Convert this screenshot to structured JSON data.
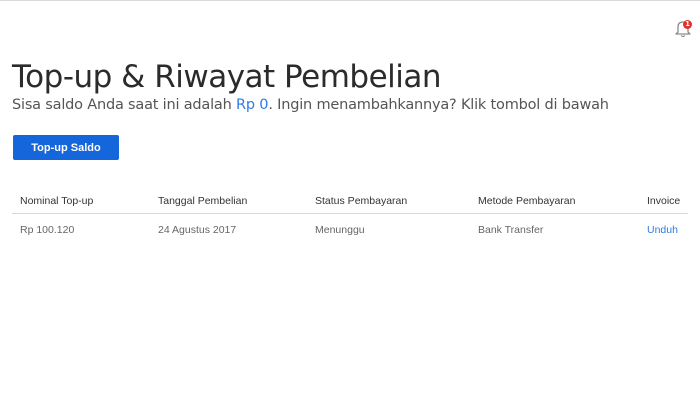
{
  "header": {
    "notification_icon": "bell-icon",
    "notification_badge": "1",
    "badge_color": "#e0322d"
  },
  "main": {
    "title": "Top-up & Riwayat Pembelian",
    "subtitle_prefix": "Sisa saldo Anda saat ini adalah ",
    "balance": "Rp 0",
    "subtitle_suffix": ". Ingin menambahkannya? Klik tombol di bawah",
    "topup_button_label": "Top-up Saldo",
    "accent_color": "#1565db",
    "link_color": "#2f7be3"
  },
  "table": {
    "headers": [
      "Nominal Top-up",
      "Tanggal Pembelian",
      "Status Pembayaran",
      "Metode Pembayaran",
      "Invoice"
    ],
    "rows": [
      [
        "Rp 100.120",
        "24 Agustus 2017",
        "Menunggu",
        "Bank Transfer",
        "Unduh"
      ]
    ]
  }
}
